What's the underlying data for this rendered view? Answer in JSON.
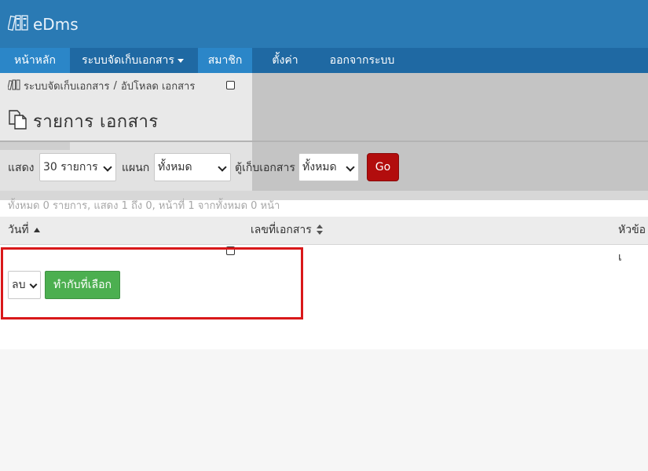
{
  "app": {
    "brand": "eDms"
  },
  "nav": {
    "items": [
      {
        "label": "หน้าหลัก"
      },
      {
        "label": "ระบบจัดเก็บเอกสาร"
      },
      {
        "label": "สมาชิก"
      },
      {
        "label": "ตั้งค่า"
      },
      {
        "label": "ออกจากระบบ"
      }
    ]
  },
  "breadcrumb": {
    "items": [
      "ระบบจัดเก็บเอกสาร",
      "อัปโหลด เอกสาร"
    ],
    "separator": "/"
  },
  "page": {
    "title": "รายการ เอกสาร"
  },
  "filters": {
    "show_label": "แสดง",
    "show_value": "30 รายการ",
    "department_label": "แผนก",
    "department_value": "ทั้งหมด",
    "cabinet_label": "ตู้เก็บเอกสาร",
    "cabinet_value": "ทั้งหมด",
    "go_label": "Go"
  },
  "summary": "ทั้งหมด 0 รายการ, แสดง 1 ถึง 0, หน้าที่ 1 จากทั้งหมด 0 หน้า",
  "table": {
    "columns": [
      {
        "label": "วันที่"
      },
      {
        "label": "เลขที่เอกสาร"
      },
      {
        "label": "หัวข้อเ"
      }
    ]
  },
  "actions": {
    "select_value": "ลบ",
    "apply_label": "ทำกับที่เลือก"
  },
  "colors": {
    "header": "#2a7ab4",
    "navbar": "#1f69a3",
    "nav_active": "#2b86c8",
    "go_button": "#b20d0d",
    "apply_button": "#4caf50",
    "highlight_box": "#d9181a"
  },
  "icons": {
    "brand": "binders-icon",
    "breadcrumb": "binders-icon",
    "title": "documents-icon"
  }
}
